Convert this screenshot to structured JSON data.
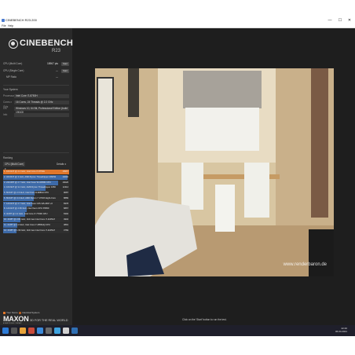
{
  "window": {
    "title": "CINEBENCH R23.200",
    "controls": [
      "—",
      "☐",
      "✕"
    ]
  },
  "menu": [
    "File",
    "Help"
  ],
  "logo": {
    "name": "CINEBENCH",
    "version": "R23"
  },
  "tests": [
    {
      "label": "CPU (Multi Core)",
      "value": "18967 pts",
      "button": "Start"
    },
    {
      "label": "CPU (Single Core)",
      "value": "---",
      "button": "Start"
    },
    {
      "label": "MP Ratio",
      "value": "---"
    }
  ],
  "system": {
    "title": "Your System",
    "rows": [
      {
        "label": "Processor",
        "value": "Intel Core i7-8750H"
      },
      {
        "label": "Cores x GHz",
        "value": "16 Cores, 24 Threads @ 2.2 GHz"
      },
      {
        "label": "OS",
        "value": "Windows 10, 64 Bit, Professional Edition (build 19043)"
      },
      {
        "label": "Info",
        "value": ""
      }
    ]
  },
  "ranking": {
    "title": "Ranking",
    "select": "CPU (Multi Core)",
    "details": "Details",
    "rows": [
      {
        "name": "1. 16C/24T @ 2.4 GHz, Intel Core i7-8750H",
        "score": "18967",
        "frac": 1.0,
        "mine": true
      },
      {
        "name": "2. 32C/64T @ 3 GHz, AMD Ryzen Threadripper 2990WX 32-C",
        "score": "19292",
        "frac": 0.98,
        "mine": false
      },
      {
        "name": "3. 24C/48T @ 2.7 GHz, Intel Xeon W-3265M CPU",
        "score": "16026",
        "frac": 0.83,
        "mine": false
      },
      {
        "name": "4. 16C/32T @ 3.4 GHz, AMD Ryzen Threadripper 1950X 16-C",
        "score": "12114",
        "frac": 0.64,
        "mine": false
      },
      {
        "name": "5. 8C/16T @ 2.3 GHz, Intel Core i9-9880H CPU",
        "score": "9087",
        "frac": 0.48,
        "mine": false
      },
      {
        "name": "6. 8C/16T @ 3.4 GHz, AMD Ryzen 7 1700X Eight-Core Process",
        "score": "8889",
        "frac": 0.47,
        "mine": false
      },
      {
        "name": "7. 12C/24T @ 2.7 GHz, Intel Xeon CPU E5-2697 v2",
        "score": "8378",
        "frac": 0.44,
        "mine": false
      },
      {
        "name": "8. 12C/24T @ 2.66 GHz, Intel Xeon CPU X5650",
        "score": "6867",
        "frac": 0.36,
        "mine": false
      },
      {
        "name": "9. 4C/8T @ 4.2 GHz, Intel Core i7-7700K CPU",
        "score": "6302",
        "frac": 0.33,
        "mine": false
      },
      {
        "name": "10. 4C/8T @ 2.81 GHz, 11th Gen Intel Core i7-1165G7 @ 28W",
        "score": "4904",
        "frac": 0.26,
        "mine": false
      },
      {
        "name": "11. 4C/8T @ 2.3 GHz, Intel Core i7-4850HQ CPU",
        "score": "3891",
        "frac": 0.21,
        "mine": false
      },
      {
        "name": "12. 4C/8T @ 1.69 GHz, 11th Gen Intel Core i7-1165G7 @ 15W",
        "score": "3769",
        "frac": 0.2,
        "mine": false
      }
    ]
  },
  "legend": {
    "your_score": "Your Score",
    "identical": "Identical System",
    "your_color": "#e0762a",
    "identical_color": "#b05a20"
  },
  "brand": {
    "name": "MAXON",
    "sub": "A NEMETSCHEK COMPANY",
    "tagline": "3D FOR THE REAL WORLD"
  },
  "render": {
    "hint": "Click on the 'Start' button to run the test.",
    "watermark": "www.renderbaron.de"
  },
  "tray": {
    "time": "22:40",
    "date": "06.04.2021"
  }
}
